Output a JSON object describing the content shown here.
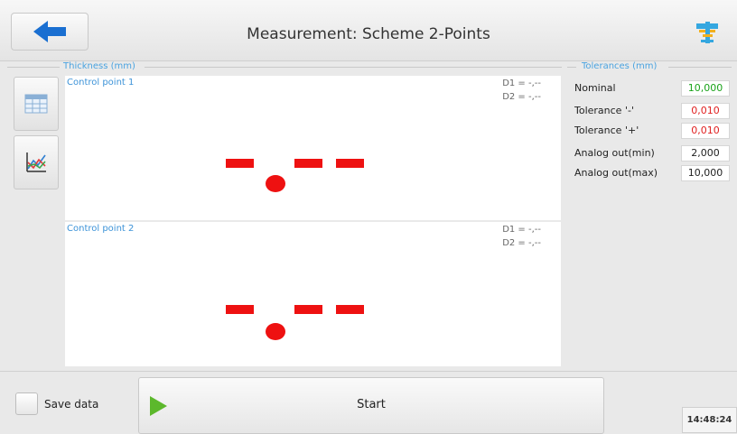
{
  "header": {
    "title": "Measurement: Scheme 2-Points",
    "back_icon": "arrow-left-icon",
    "settings_icon": "caliper-settings-icon"
  },
  "thickness_group": {
    "title": "Thickness (mm)"
  },
  "tools": [
    {
      "icon": "table-icon"
    },
    {
      "icon": "chart-icon"
    }
  ],
  "panels": [
    {
      "label": "Control point 1",
      "d1": "D1 = -,--",
      "d2": "D2 = -,--"
    },
    {
      "label": "Control point 2",
      "d1": "D1 = -,--",
      "d2": "D2 = -,--"
    }
  ],
  "tolerances": {
    "title": "Tolerances (mm)",
    "rows": [
      {
        "label": "Nominal",
        "value": "10,000",
        "color": "#1aa31a"
      },
      {
        "label": "Tolerance '-'",
        "value": "0,010",
        "color": "#e02020"
      },
      {
        "label": "Tolerance '+'",
        "value": "0,010",
        "color": "#e02020"
      },
      {
        "label": "Analog out(min)",
        "value": "2,000",
        "color": "#222222"
      },
      {
        "label": "Analog out(max)",
        "value": "10,000",
        "color": "#222222"
      }
    ]
  },
  "footer": {
    "save_label": "Save data",
    "start_label": "Start",
    "time": "14:48:24"
  },
  "colors": {
    "accent": "#1a6fd1",
    "indicator": "#ee1111",
    "play": "#5cb82c"
  }
}
